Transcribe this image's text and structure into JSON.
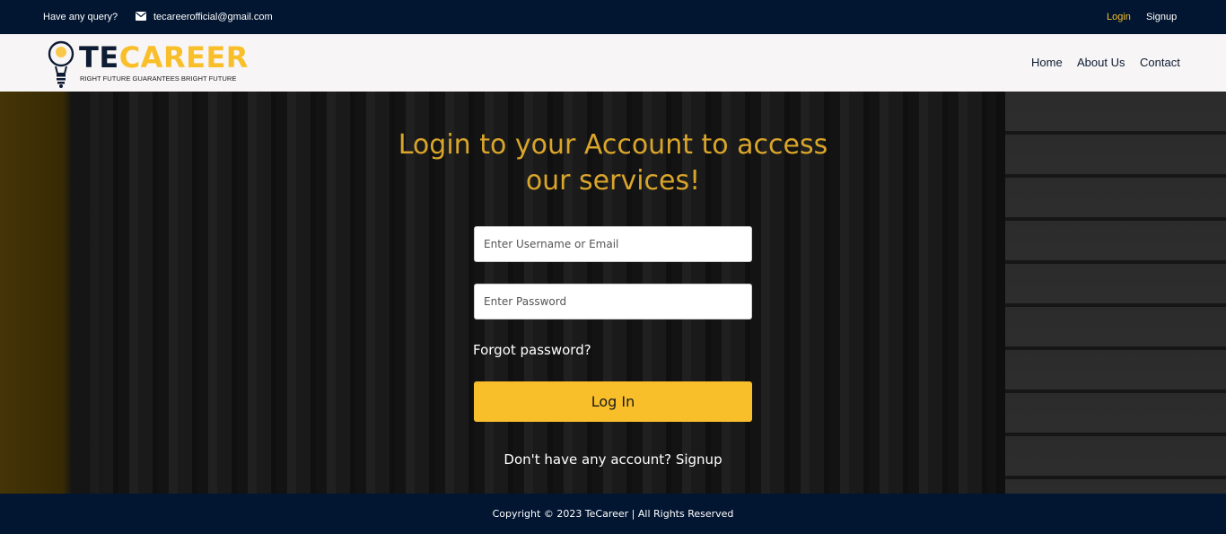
{
  "topbar": {
    "query_label": "Have any query?",
    "email_icon": "envelope-icon",
    "email": "tecareerofficial@gmail.com",
    "login": "Login",
    "signup": "Signup",
    "accent_color": "#f9bf2b"
  },
  "navbar": {
    "logo": {
      "brand_part1": "TE",
      "brand_part2": "CAREER",
      "tagline": "RIGHT FUTURE GUARANTEES BRIGHT FUTURE",
      "icon": "lightbulb-icon"
    },
    "links": [
      "Home",
      "About Us",
      "Contact"
    ]
  },
  "hero": {
    "title": "Login to your Account to access our services!",
    "username_placeholder": "Enter Username or Email",
    "password_placeholder": "Enter Password",
    "forgot": "Forgot password?",
    "login_button": "Log In",
    "no_account": "Don't have any account?",
    "signup_link": "Signup",
    "title_color": "#d9a52a",
    "button_color": "#f9bf2b"
  },
  "footer": {
    "copyright": "Copyright © 2023 TeCareer | All Rights Reserved"
  }
}
